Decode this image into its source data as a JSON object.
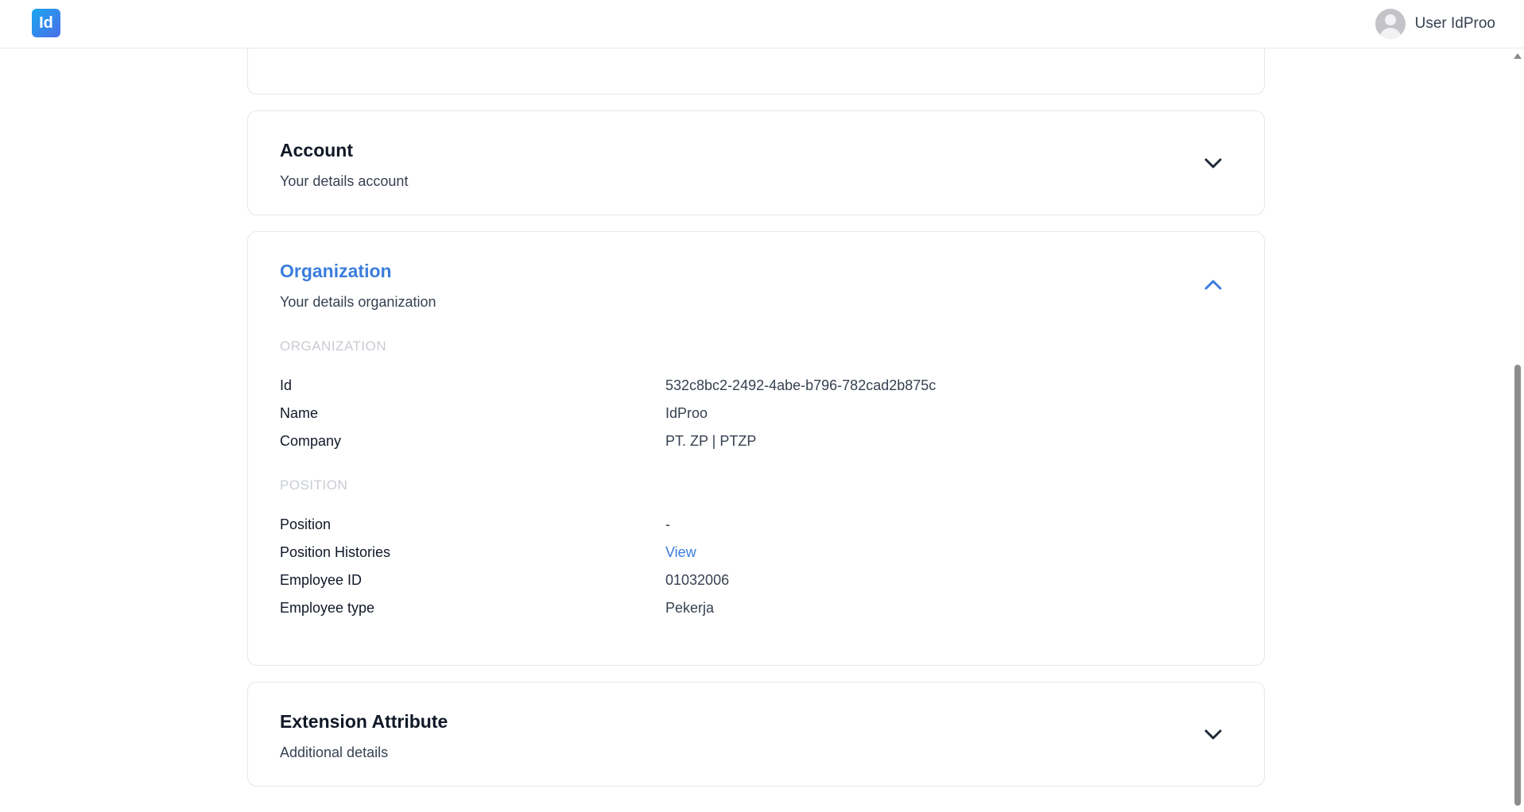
{
  "header": {
    "logo_text": "Id",
    "user_name": "User IdProo"
  },
  "sections": {
    "account": {
      "title": "Account",
      "subtitle": "Your details account",
      "expanded": false
    },
    "organization": {
      "title": "Organization",
      "subtitle": "Your details organization",
      "expanded": true,
      "org_heading": "ORGANIZATION",
      "org_rows": [
        {
          "label": "Id",
          "value": "532c8bc2-2492-4abe-b796-782cad2b875c"
        },
        {
          "label": "Name",
          "value": "IdProo"
        },
        {
          "label": "Company",
          "value": "PT. ZP | PTZP"
        }
      ],
      "position_heading": "POSITION",
      "position_rows": [
        {
          "label": "Position",
          "value": "-"
        },
        {
          "label": "Position Histories",
          "value": "View"
        },
        {
          "label": "Employee ID",
          "value": "01032006"
        },
        {
          "label": "Employee type",
          "value": "Pekerja"
        }
      ]
    },
    "extension": {
      "title": "Extension Attribute",
      "subtitle": "Additional details",
      "expanded": false
    }
  },
  "colors": {
    "accent": "#3b7ddd",
    "muted_heading": "#c8ccd2",
    "border": "#e5e7eb"
  },
  "icons": {
    "collapsed": "chevron-down-icon",
    "expanded": "chevron-up-icon",
    "avatar": "user-avatar-icon"
  }
}
